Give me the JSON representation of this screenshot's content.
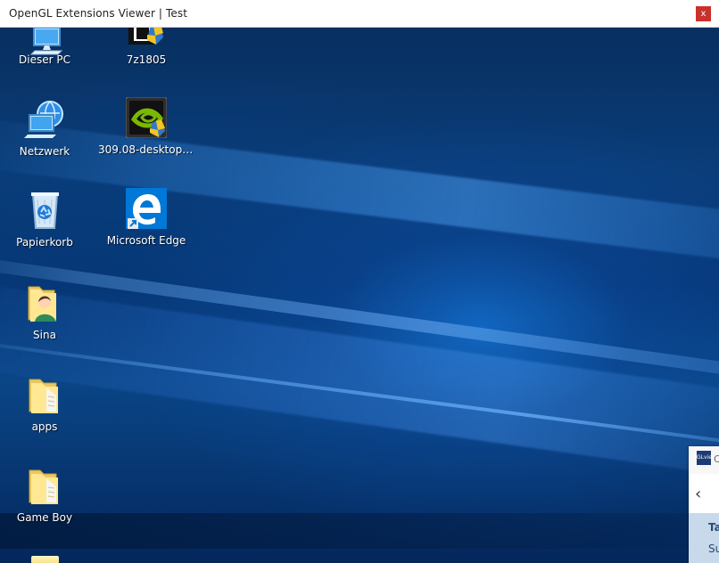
{
  "window": {
    "title": "OpenGL Extensions Viewer | Test",
    "close_label": "x"
  },
  "desktop": {
    "icons": [
      {
        "label": "Dieser PC",
        "icon": "computer-icon"
      },
      {
        "label": "7z1805",
        "icon": "installer-shield-icon"
      },
      {
        "label": "Netzwerk",
        "icon": "network-icon"
      },
      {
        "label": "309.08-desktop-wi...",
        "icon": "nvidia-installer-icon"
      },
      {
        "label": "Papierkorb",
        "icon": "recycle-bin-icon"
      },
      {
        "label": "Microsoft Edge",
        "icon": "edge-icon"
      },
      {
        "label": "Sina",
        "icon": "user-folder-icon"
      },
      {
        "label": "apps",
        "icon": "folder-icon"
      },
      {
        "label": "Game Boy",
        "icon": "folder-icon"
      }
    ]
  },
  "side_panel": {
    "logo_text": "GLview",
    "partial_letter": "C",
    "back_label": "‹",
    "partial_title": "Ta",
    "partial_subtitle": "Su"
  },
  "colors": {
    "desktop_dark": "#082f60",
    "desktop_blue": "#0a4687",
    "close_red": "#c9312b"
  }
}
